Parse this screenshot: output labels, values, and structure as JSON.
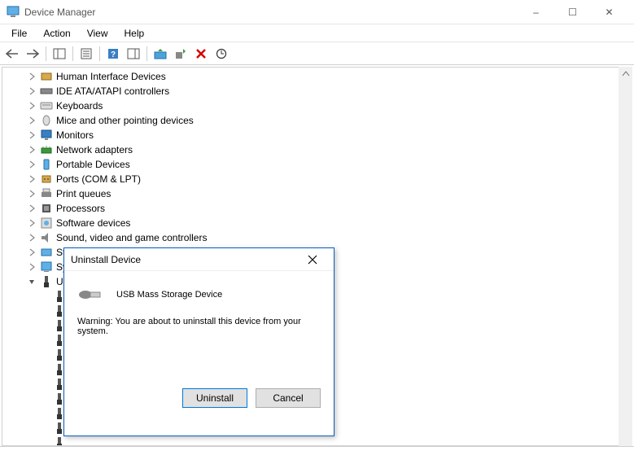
{
  "window": {
    "title": "Device Manager",
    "controls": {
      "min": "–",
      "max": "☐",
      "close": "✕"
    }
  },
  "menubar": [
    "File",
    "Action",
    "View",
    "Help"
  ],
  "tree": [
    {
      "name": "Human Interface Devices",
      "icon": "hid"
    },
    {
      "name": "IDE ATA/ATAPI controllers",
      "icon": "ide"
    },
    {
      "name": "Keyboards",
      "icon": "keyboard"
    },
    {
      "name": "Mice and other pointing devices",
      "icon": "mouse"
    },
    {
      "name": "Monitors",
      "icon": "monitor"
    },
    {
      "name": "Network adapters",
      "icon": "net"
    },
    {
      "name": "Portable Devices",
      "icon": "portable"
    },
    {
      "name": "Ports (COM & LPT)",
      "icon": "port"
    },
    {
      "name": "Print queues",
      "icon": "printer"
    },
    {
      "name": "Processors",
      "icon": "cpu"
    },
    {
      "name": "Software devices",
      "icon": "software"
    },
    {
      "name": "Sound, video and game controllers",
      "icon": "sound"
    },
    {
      "name": "Sto",
      "icon": "storage"
    },
    {
      "name": "Sys",
      "icon": "system"
    },
    {
      "name": "Un",
      "icon": "usb",
      "expanded": true,
      "children": 11
    }
  ],
  "dialog": {
    "title": "Uninstall Device",
    "device": "USB Mass Storage Device",
    "warning": "Warning: You are about to uninstall this device from your system.",
    "buttons": {
      "primary": "Uninstall",
      "secondary": "Cancel"
    }
  }
}
